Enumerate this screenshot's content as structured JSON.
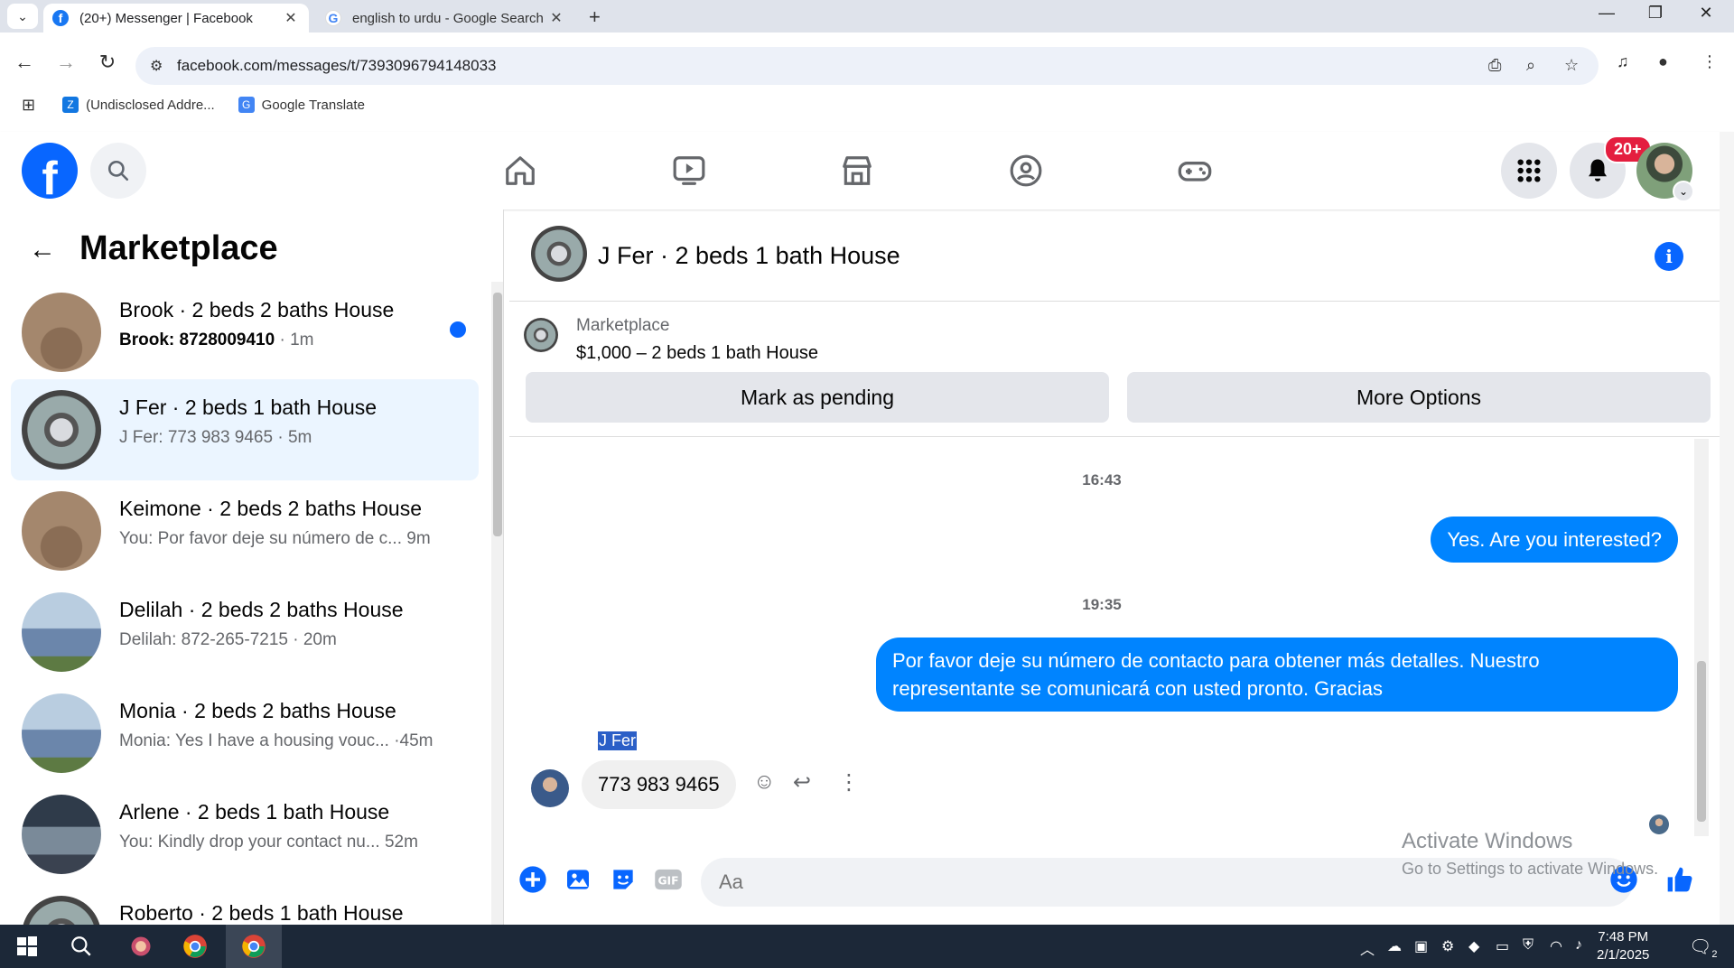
{
  "browser": {
    "tabs": [
      {
        "title": "(20+) Messenger | Facebook",
        "favicon": "facebook-icon"
      },
      {
        "title": "english to urdu - Google Search",
        "favicon": "google-icon"
      }
    ],
    "url": "facebook.com/messages/t/7393096794148033",
    "bookmarks": [
      {
        "label": "(Undisclosed Addre...",
        "icon": "zillow-icon"
      },
      {
        "label": "Google Translate",
        "icon": "google-translate-icon"
      }
    ]
  },
  "facebook": {
    "logo": "f",
    "notification_count": "20+",
    "brand_color": "#0866ff"
  },
  "sidebar": {
    "title": "Marketplace",
    "conversations": [
      {
        "name": "Brook · 2 beds 2 baths House",
        "preview": "Brook: 8728009410",
        "time": "1m",
        "unread": true
      },
      {
        "name": "J Fer · 2 beds 1 bath House",
        "preview": "J Fer: 773 983 9465",
        "time": "5m",
        "unread": false
      },
      {
        "name": "Keimone · 2 beds 2 baths House",
        "preview": "You: Por favor deje su número de c...",
        "time": "9m",
        "unread": false
      },
      {
        "name": "Delilah · 2 beds 2 baths House",
        "preview": "Delilah: 872-265-7215",
        "time": "20m",
        "unread": false
      },
      {
        "name": "Monia · 2 beds 2 baths House",
        "preview": "Monia: Yes I have a housing vouc...",
        "time": "45m",
        "unread": false
      },
      {
        "name": "Arlene · 2 beds 1 bath House",
        "preview": "You: Kindly drop your contact nu...",
        "time": "52m",
        "unread": false
      },
      {
        "name": "Roberto · 2 beds 1 bath House",
        "preview": "",
        "time": "",
        "unread": false
      }
    ]
  },
  "chat": {
    "title": "J Fer · 2 beds 1 bath House",
    "listing": {
      "label": "Marketplace",
      "price_line": "$1,000 – 2 beds 1 bath House",
      "mark_pending": "Mark as pending",
      "more_options": "More Options"
    },
    "messages": [
      {
        "type": "time",
        "text": "16:43"
      },
      {
        "type": "out",
        "text": "Yes. Are you interested?"
      },
      {
        "type": "time",
        "text": "19:35"
      },
      {
        "type": "out",
        "text": "Por favor deje su número de contacto para obtener más detalles. Nuestro representante se comunicará con usted pronto. Gracias"
      },
      {
        "type": "sender",
        "text": "J Fer"
      },
      {
        "type": "in",
        "text": "773 983 9465"
      }
    ],
    "composer_placeholder": "Aa",
    "bubble_color": "#0084ff"
  },
  "watermark": {
    "line1": "Activate Windows",
    "line2": "Go to Settings to activate Windows."
  },
  "taskbar": {
    "time": "7:48 PM",
    "date": "2/1/2025",
    "notification_count": "2"
  }
}
